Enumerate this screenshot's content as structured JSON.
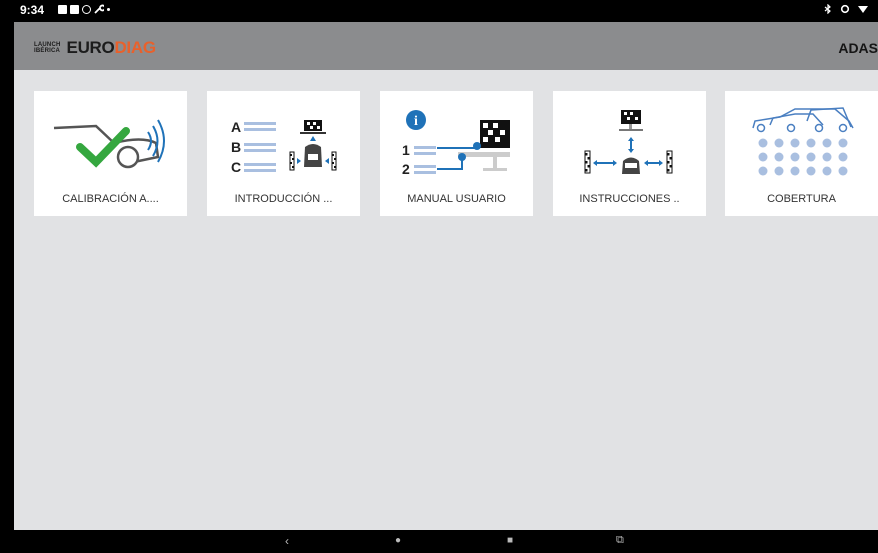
{
  "status_bar": {
    "time": "9:34",
    "left_icons": [
      "image-icon",
      "message-icon",
      "settings-icon",
      "wrench-icon",
      "dot-icon"
    ],
    "right_icons": [
      "bluetooth-icon",
      "location-icon",
      "wifi-icon"
    ]
  },
  "app_bar": {
    "logo_line1": "LAUNCH",
    "logo_line2": "IBÉRICA",
    "logo_euro": "EURO",
    "logo_diag": "DIAG",
    "title": "ADAS",
    "colors": {
      "background": "#8b8c8e",
      "logo_accent": "#e8612c"
    }
  },
  "tiles": [
    {
      "label": "CALIBRACIÓN A....",
      "icon": "car-sensor-check-icon"
    },
    {
      "label": "INTRODUCCIÓN ...",
      "icon": "abc-list-target-icon",
      "letters": [
        "A",
        "B",
        "C"
      ]
    },
    {
      "label": "MANUAL USUARIO",
      "icon": "manual-info-icon",
      "info_glyph": "i",
      "numbers": [
        "1",
        "2"
      ]
    },
    {
      "label": "INSTRUCCIONES ..",
      "icon": "instructions-target-icon"
    },
    {
      "label": "COBERTURA",
      "icon": "coverage-cars-icon"
    }
  ],
  "nav_bar": {
    "back": "‹",
    "home": "●",
    "recents": "■",
    "extra": "⧉"
  },
  "colors": {
    "accent_blue": "#1f72b8",
    "check_green": "#35a73f",
    "light_blue": "#a9bfe0",
    "page_bg": "#e1e2e4"
  }
}
